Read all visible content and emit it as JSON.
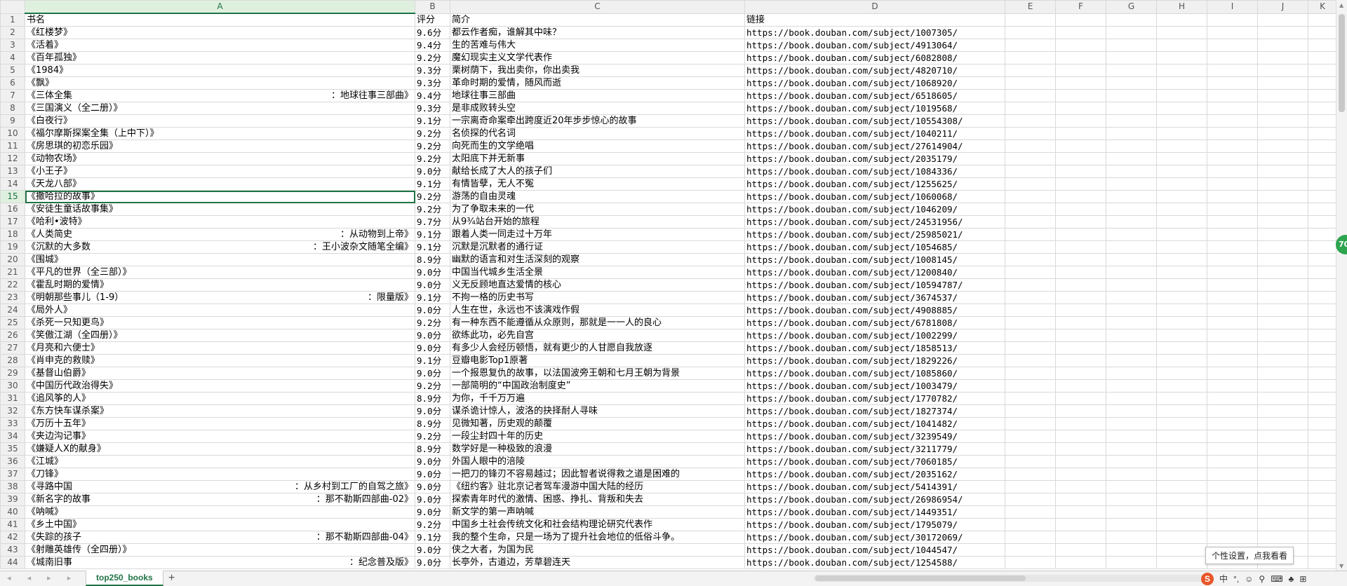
{
  "columns": [
    "A",
    "B",
    "C",
    "D",
    "E",
    "F",
    "G",
    "H",
    "I",
    "J",
    "K"
  ],
  "active_cell": {
    "row": 15,
    "col": "A"
  },
  "headers": {
    "title": "书名",
    "rating": "评分",
    "intro": "简介",
    "link": "链接"
  },
  "rows": [
    {
      "r": 2,
      "title": "《红楼梦》",
      "sub": "",
      "rating": "9.6分",
      "intro": "都云作者痴，谁解其中味？",
      "link": "https://book.douban.com/subject/1007305/"
    },
    {
      "r": 3,
      "title": "《活着》",
      "sub": "",
      "rating": "9.4分",
      "intro": "生的苦难与伟大",
      "link": "https://book.douban.com/subject/4913064/"
    },
    {
      "r": 4,
      "title": "《百年孤独》",
      "sub": "",
      "rating": "9.2分",
      "intro": "魔幻现实主义文学代表作",
      "link": "https://book.douban.com/subject/6082808/"
    },
    {
      "r": 5,
      "title": "《1984》",
      "sub": "",
      "rating": "9.3分",
      "intro": "栗树荫下，我出卖你，你出卖我",
      "link": "https://book.douban.com/subject/4820710/"
    },
    {
      "r": 6,
      "title": "《飘》",
      "sub": "",
      "rating": "9.3分",
      "intro": "革命时期的爱情，随风而逝",
      "link": "https://book.douban.com/subject/1068920/"
    },
    {
      "r": 7,
      "title": "《三体全集",
      "sub": "：地球往事三部曲》",
      "rating": "9.4分",
      "intro": "地球往事三部曲",
      "link": "https://book.douban.com/subject/6518605/"
    },
    {
      "r": 8,
      "title": "《三国演义（全二册）》",
      "sub": "",
      "rating": "9.3分",
      "intro": "是非成败转头空",
      "link": "https://book.douban.com/subject/1019568/"
    },
    {
      "r": 9,
      "title": "《白夜行》",
      "sub": "",
      "rating": "9.1分",
      "intro": "一宗离奇命案牵出跨度近20年步步惊心的故事",
      "link": "https://book.douban.com/subject/10554308/"
    },
    {
      "r": 10,
      "title": "《福尔摩斯探案全集（上中下）》",
      "sub": "",
      "rating": "9.2分",
      "intro": "名侦探的代名词",
      "link": "https://book.douban.com/subject/1040211/"
    },
    {
      "r": 11,
      "title": "《房思琪的初恋乐园》",
      "sub": "",
      "rating": "9.2分",
      "intro": "向死而生的文学绝唱",
      "link": "https://book.douban.com/subject/27614904/"
    },
    {
      "r": 12,
      "title": "《动物农场》",
      "sub": "",
      "rating": "9.2分",
      "intro": "太阳底下并无新事",
      "link": "https://book.douban.com/subject/2035179/"
    },
    {
      "r": 13,
      "title": "《小王子》",
      "sub": "",
      "rating": "9.0分",
      "intro": "献给长成了大人的孩子们",
      "link": "https://book.douban.com/subject/1084336/"
    },
    {
      "r": 14,
      "title": "《天龙八部》",
      "sub": "",
      "rating": "9.1分",
      "intro": "有情皆孽，无人不冤",
      "link": "https://book.douban.com/subject/1255625/"
    },
    {
      "r": 15,
      "title": "《撒哈拉的故事》",
      "sub": "",
      "rating": "9.2分",
      "intro": "游荡的自由灵魂",
      "link": "https://book.douban.com/subject/1060068/"
    },
    {
      "r": 16,
      "title": "《安徒生童话故事集》",
      "sub": "",
      "rating": "9.2分",
      "intro": "为了争取未来的一代",
      "link": "https://book.douban.com/subject/1046209/"
    },
    {
      "r": 17,
      "title": "《哈利•波特》",
      "sub": "",
      "rating": "9.7分",
      "intro": "从9¾站台开始的旅程",
      "link": "https://book.douban.com/subject/24531956/"
    },
    {
      "r": 18,
      "title": "《人类简史",
      "sub": "：从动物到上帝》",
      "rating": "9.1分",
      "intro": "跟着人类一同走过十万年",
      "link": "https://book.douban.com/subject/25985021/"
    },
    {
      "r": 19,
      "title": "《沉默的大多数",
      "sub": "：王小波杂文随笔全编》",
      "rating": "9.1分",
      "intro": "沉默是沉默者的通行证",
      "link": "https://book.douban.com/subject/1054685/"
    },
    {
      "r": 20,
      "title": "《围城》",
      "sub": "",
      "rating": "8.9分",
      "intro": "幽默的语言和对生活深刻的观察",
      "link": "https://book.douban.com/subject/1008145/"
    },
    {
      "r": 21,
      "title": "《平凡的世界（全三部）》",
      "sub": "",
      "rating": "9.0分",
      "intro": "中国当代城乡生活全景",
      "link": "https://book.douban.com/subject/1200840/"
    },
    {
      "r": 22,
      "title": "《霍乱时期的爱情》",
      "sub": "",
      "rating": "9.0分",
      "intro": "义无反顾地直达爱情的核心",
      "link": "https://book.douban.com/subject/10594787/"
    },
    {
      "r": 23,
      "title": "《明朝那些事儿（1-9）",
      "sub": "：限量版》",
      "rating": "9.1分",
      "intro": "不拘一格的历史书写",
      "link": "https://book.douban.com/subject/3674537/"
    },
    {
      "r": 24,
      "title": "《局外人》",
      "sub": "",
      "rating": "9.0分",
      "intro": "人生在世，永远也不该演戏作假",
      "link": "https://book.douban.com/subject/4908885/"
    },
    {
      "r": 25,
      "title": "《杀死一只知更鸟》",
      "sub": "",
      "rating": "9.2分",
      "intro": "有一种东西不能遵循从众原则，那就是一一人的良心",
      "link": "https://book.douban.com/subject/6781808/"
    },
    {
      "r": 26,
      "title": "《笑傲江湖（全四册）》",
      "sub": "",
      "rating": "9.0分",
      "intro": "欲练此功，必先自宫",
      "link": "https://book.douban.com/subject/1002299/"
    },
    {
      "r": 27,
      "title": "《月亮和六便士》",
      "sub": "",
      "rating": "9.0分",
      "intro": "有多少人会经历顿悟，就有更少的人甘愿自我放逐",
      "link": "https://book.douban.com/subject/1858513/"
    },
    {
      "r": 28,
      "title": "《肖申克的救赎》",
      "sub": "",
      "rating": "9.1分",
      "intro": "豆瓣电影Top1原著",
      "link": "https://book.douban.com/subject/1829226/"
    },
    {
      "r": 29,
      "title": "《基督山伯爵》",
      "sub": "",
      "rating": "9.0分",
      "intro": "一个报恩复仇的故事，以法国波旁王朝和七月王朝为背景",
      "link": "https://book.douban.com/subject/1085860/"
    },
    {
      "r": 30,
      "title": "《中国历代政治得失》",
      "sub": "",
      "rating": "9.2分",
      "intro": "一部简明的“中国政治制度史”",
      "link": "https://book.douban.com/subject/1003479/"
    },
    {
      "r": 31,
      "title": "《追风筝的人》",
      "sub": "",
      "rating": "8.9分",
      "intro": "为你，千千万万遍",
      "link": "https://book.douban.com/subject/1770782/"
    },
    {
      "r": 32,
      "title": "《东方快车谋杀案》",
      "sub": "",
      "rating": "9.0分",
      "intro": "谋杀诡计惊人，波洛的抉择耐人寻味",
      "link": "https://book.douban.com/subject/1827374/"
    },
    {
      "r": 33,
      "title": "《万历十五年》",
      "sub": "",
      "rating": "8.9分",
      "intro": "见微知著，历史观的颠覆",
      "link": "https://book.douban.com/subject/1041482/"
    },
    {
      "r": 34,
      "title": "《夹边沟记事》",
      "sub": "",
      "rating": "9.2分",
      "intro": "一段尘封四十年的历史",
      "link": "https://book.douban.com/subject/3239549/"
    },
    {
      "r": 35,
      "title": "《嫌疑人X的献身》",
      "sub": "",
      "rating": "8.9分",
      "intro": "数学好是一种极致的浪漫",
      "link": "https://book.douban.com/subject/3211779/"
    },
    {
      "r": 36,
      "title": "《江城》",
      "sub": "",
      "rating": "9.0分",
      "intro": "外国人眼中的涪陵",
      "link": "https://book.douban.com/subject/7060185/"
    },
    {
      "r": 37,
      "title": "《刀锋》",
      "sub": "",
      "rating": "9.0分",
      "intro": "一把刀的锋刃不容易越过；因此智者说得救之道是困难的",
      "link": "https://book.douban.com/subject/2035162/"
    },
    {
      "r": 38,
      "title": "《寻路中国",
      "sub": "：从乡村到工厂的自驾之旅》",
      "rating": "9.0分",
      "intro": "《纽约客》驻北京记者驾车漫游中国大陆的经历",
      "link": "https://book.douban.com/subject/5414391/"
    },
    {
      "r": 39,
      "title": "《新名字的故事",
      "sub": "：那不勒斯四部曲-02》",
      "rating": "9.0分",
      "intro": "探索青年时代的激情、困惑、挣扎、背叛和失去",
      "link": "https://book.douban.com/subject/26986954/"
    },
    {
      "r": 40,
      "title": "《呐喊》",
      "sub": "",
      "rating": "9.0分",
      "intro": "新文学的第一声呐喊",
      "link": "https://book.douban.com/subject/1449351/"
    },
    {
      "r": 41,
      "title": "《乡土中国》",
      "sub": "",
      "rating": "9.2分",
      "intro": "中国乡土社会传统文化和社会结构理论研究代表作",
      "link": "https://book.douban.com/subject/1795079/"
    },
    {
      "r": 42,
      "title": "《失踪的孩子",
      "sub": "：那不勒斯四部曲-04》",
      "rating": "9.1分",
      "intro": "我的整个生命，只是一场为了提升社会地位的低俗斗争。",
      "link": "https://book.douban.com/subject/30172069/"
    },
    {
      "r": 43,
      "title": "《射雕英雄传（全四册）》",
      "sub": "",
      "rating": "9.0分",
      "intro": "侠之大者，为国为民",
      "link": "https://book.douban.com/subject/1044547/"
    },
    {
      "r": 44,
      "title": "《城南旧事",
      "sub": "：纪念普及版》",
      "rating": "9.0分",
      "intro": "长亭外，古道边，芳草碧连天",
      "link": "https://book.douban.com/subject/1254588/"
    }
  ],
  "tabbar": {
    "nav": "◂ ◂ ▸ ▸",
    "sheet_tab": "top250_books",
    "add": "+"
  },
  "tooltip": "个性设置，点我看看",
  "ime": {
    "logo": "S",
    "lang": "中",
    "punct": "°,",
    "emoji": "☺",
    "mic": "⚲",
    "keyboard": "⌨",
    "skin": "♣",
    "grid": "⊞"
  },
  "badge": "70",
  "colors": {
    "accent": "#217346",
    "grid": "#d9d9d9",
    "header_bg": "#f0f0f0"
  }
}
